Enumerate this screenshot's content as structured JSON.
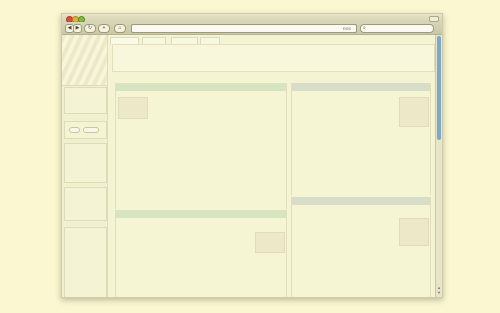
{
  "browser": {
    "toolbar": {
      "back_label": "◀",
      "forward_label": "▶",
      "reload_label": "↻",
      "add_label": "+",
      "home_label": "⌂",
      "rss_label": "RSS",
      "address_value": "",
      "search_value": "",
      "search_icon": "magnifier-icon"
    }
  },
  "page": {
    "tabs": [
      "",
      "",
      "",
      ""
    ],
    "sidebar": {
      "buttons": [
        "",
        ""
      ]
    },
    "panels": [
      {
        "header": "",
        "header_color": "#d6e4bf"
      },
      {
        "header": "",
        "header_color": "#d8ddc8"
      },
      {
        "header": "",
        "header_color": "#d6e4bf"
      },
      {
        "header": "",
        "header_color": "#d8ddc8"
      }
    ]
  },
  "colors": {
    "background": "#fbf7d0",
    "window": "#f2f0cf",
    "accent_green": "#d6e4bf",
    "accent_gray": "#d8ddc8",
    "scroll_thumb": "#7fa7c9"
  }
}
